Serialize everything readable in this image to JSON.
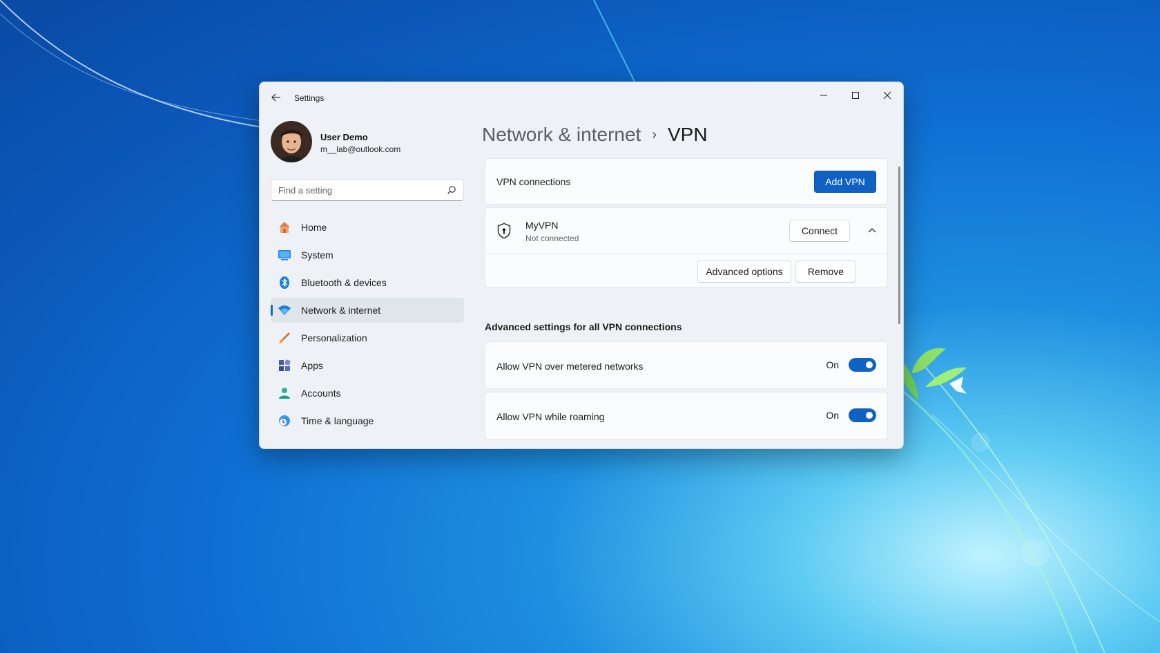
{
  "window": {
    "title": "Settings"
  },
  "profile": {
    "name": "User Demo",
    "email": "m__lab@outlook.com"
  },
  "search": {
    "placeholder": "Find a setting"
  },
  "nav": {
    "items": [
      {
        "label": "Home",
        "icon": "home-icon"
      },
      {
        "label": "System",
        "icon": "system-icon"
      },
      {
        "label": "Bluetooth & devices",
        "icon": "bluetooth-icon"
      },
      {
        "label": "Network & internet",
        "icon": "wifi-icon",
        "active": true
      },
      {
        "label": "Personalization",
        "icon": "brush-icon"
      },
      {
        "label": "Apps",
        "icon": "apps-icon"
      },
      {
        "label": "Accounts",
        "icon": "accounts-icon"
      },
      {
        "label": "Time & language",
        "icon": "time-language-icon"
      }
    ]
  },
  "breadcrumb": {
    "parent": "Network & internet",
    "current": "VPN"
  },
  "vpn_connections": {
    "label": "VPN connections",
    "add_button": "Add VPN"
  },
  "vpn": {
    "name": "MyVPN",
    "status": "Not connected",
    "connect_button": "Connect",
    "advanced_button": "Advanced options",
    "remove_button": "Remove"
  },
  "advanced": {
    "header": "Advanced settings for all VPN connections",
    "settings": [
      {
        "label": "Allow VPN over metered networks",
        "state": "On"
      },
      {
        "label": "Allow VPN while roaming",
        "state": "On"
      }
    ]
  },
  "colors": {
    "accent": "#0f62c2",
    "window_bg": "#eef2f6",
    "card_bg": "#fbfcfd"
  }
}
